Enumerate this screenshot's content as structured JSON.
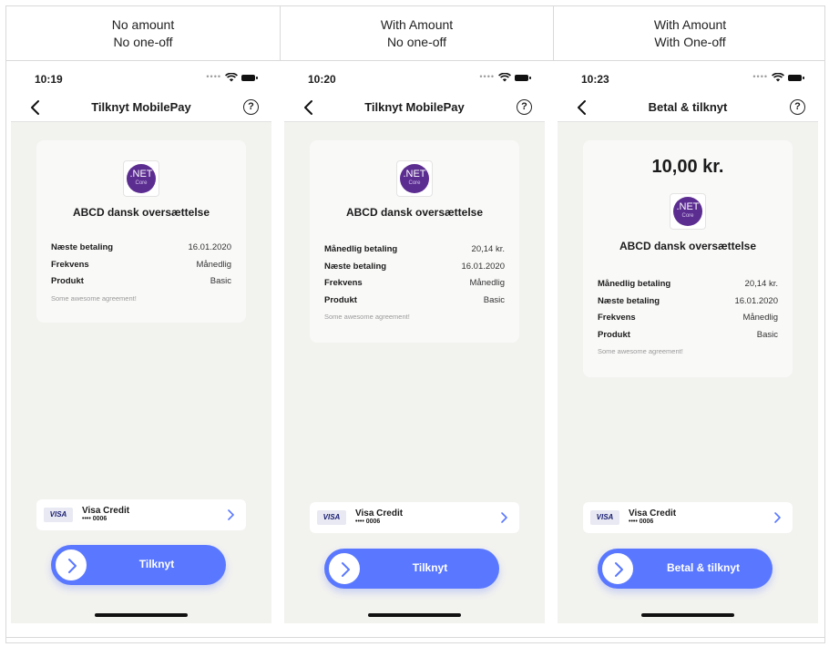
{
  "headers": [
    {
      "line1": "No amount",
      "line2": "No one-off"
    },
    {
      "line1": "With Amount",
      "line2": "No one-off"
    },
    {
      "line1": "With Amount",
      "line2": "With One-off"
    }
  ],
  "screens": [
    {
      "time": "10:19",
      "title": "Tilknyt MobilePay",
      "help": "?",
      "logo": {
        "net": ".NET",
        "core": "Core"
      },
      "merchant": "ABCD dansk oversættelse",
      "rows": [
        {
          "k": "Næste betaling",
          "v": "16.01.2020"
        },
        {
          "k": "Frekvens",
          "v": "Månedlig"
        },
        {
          "k": "Produkt",
          "v": "Basic"
        }
      ],
      "description": "Some awesome agreement!",
      "card": {
        "brand": "VISA",
        "name": "Visa Credit",
        "number": "•••• 0006"
      },
      "cta": "Tilknyt"
    },
    {
      "time": "10:20",
      "title": "Tilknyt MobilePay",
      "help": "?",
      "logo": {
        "net": ".NET",
        "core": "Core"
      },
      "merchant": "ABCD dansk oversættelse",
      "rows": [
        {
          "k": "Månedlig betaling",
          "v": "20,14 kr."
        },
        {
          "k": "Næste betaling",
          "v": "16.01.2020"
        },
        {
          "k": "Frekvens",
          "v": "Månedlig"
        },
        {
          "k": "Produkt",
          "v": "Basic"
        }
      ],
      "description": "Some awesome agreement!",
      "card": {
        "brand": "VISA",
        "name": "Visa Credit",
        "number": "•••• 0006"
      },
      "cta": "Tilknyt"
    },
    {
      "time": "10:23",
      "title": "Betal & tilknyt",
      "help": "?",
      "amount": "10,00 kr.",
      "logo": {
        "net": ".NET",
        "core": "Core"
      },
      "merchant": "ABCD dansk oversættelse",
      "rows": [
        {
          "k": "Månedlig betaling",
          "v": "20,14 kr."
        },
        {
          "k": "Næste betaling",
          "v": "16.01.2020"
        },
        {
          "k": "Frekvens",
          "v": "Månedlig"
        },
        {
          "k": "Produkt",
          "v": "Basic"
        }
      ],
      "description": "Some awesome agreement!",
      "card": {
        "brand": "VISA",
        "name": "Visa Credit",
        "number": "•••• 0006"
      },
      "cta": "Betal & tilknyt"
    }
  ],
  "colors": {
    "accent": "#5a78ff",
    "background": "#f2f2ef",
    "logo": "#5c2d91"
  }
}
